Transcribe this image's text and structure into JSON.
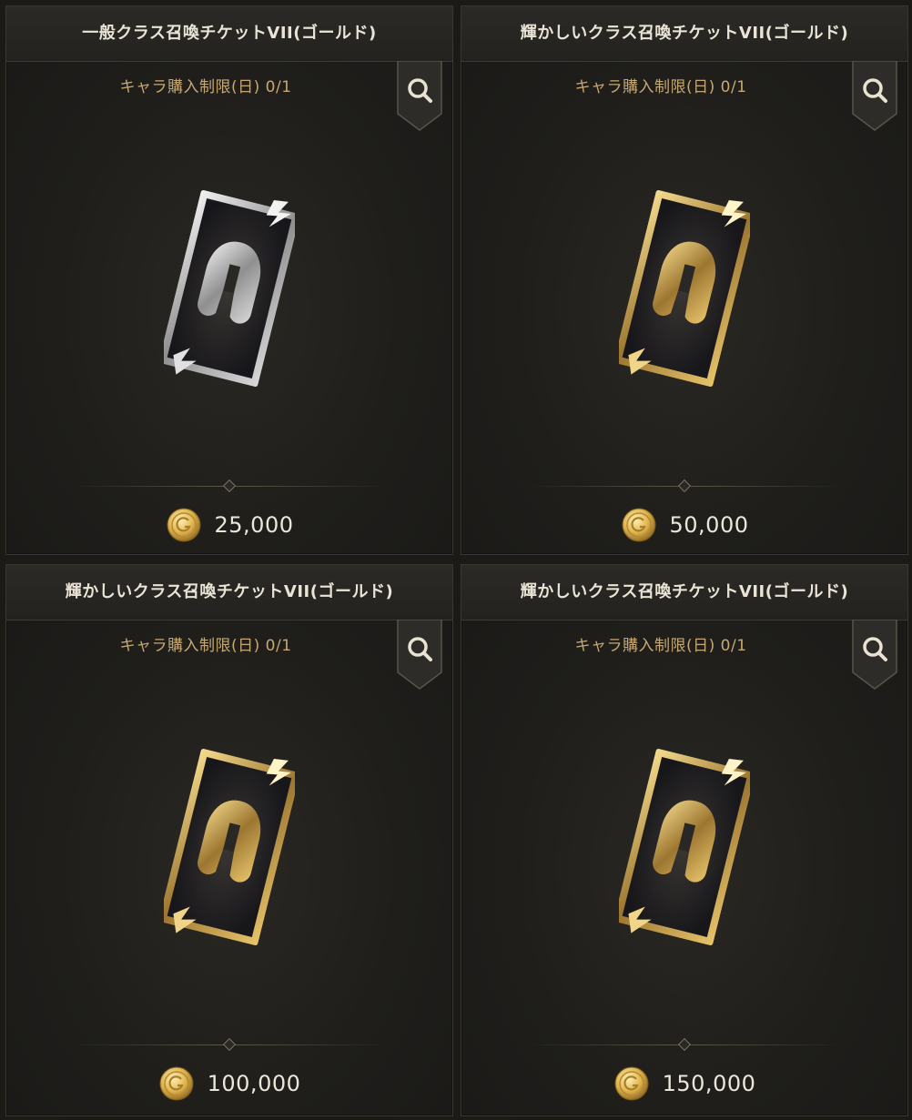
{
  "colors": {
    "background": "#1b1a17",
    "title_text": "#e9e4d6",
    "limit_text": "#c6a873",
    "price_text": "#ebe6da",
    "silver_ticket": "#c9c9c9",
    "gold_ticket": "#d4b25f"
  },
  "shop": {
    "items": [
      {
        "title": "一般クラス召喚チケットVII(ゴールド)",
        "limit": "キャラ購入制限(日) 0/1",
        "price": "25,000",
        "ticket_style": "silver",
        "currency_icon": "gold-coin-icon",
        "search_icon": "magnifier-icon"
      },
      {
        "title": "輝かしいクラス召喚チケットVII(ゴールド)",
        "limit": "キャラ購入制限(日) 0/1",
        "price": "50,000",
        "ticket_style": "gold",
        "currency_icon": "gold-coin-icon",
        "search_icon": "magnifier-icon"
      },
      {
        "title": "輝かしいクラス召喚チケットVII(ゴールド)",
        "limit": "キャラ購入制限(日) 0/1",
        "price": "100,000",
        "ticket_style": "gold",
        "currency_icon": "gold-coin-icon",
        "search_icon": "magnifier-icon"
      },
      {
        "title": "輝かしいクラス召喚チケットVII(ゴールド)",
        "limit": "キャラ購入制限(日) 0/1",
        "price": "150,000",
        "ticket_style": "gold",
        "currency_icon": "gold-coin-icon",
        "search_icon": "magnifier-icon"
      }
    ]
  }
}
